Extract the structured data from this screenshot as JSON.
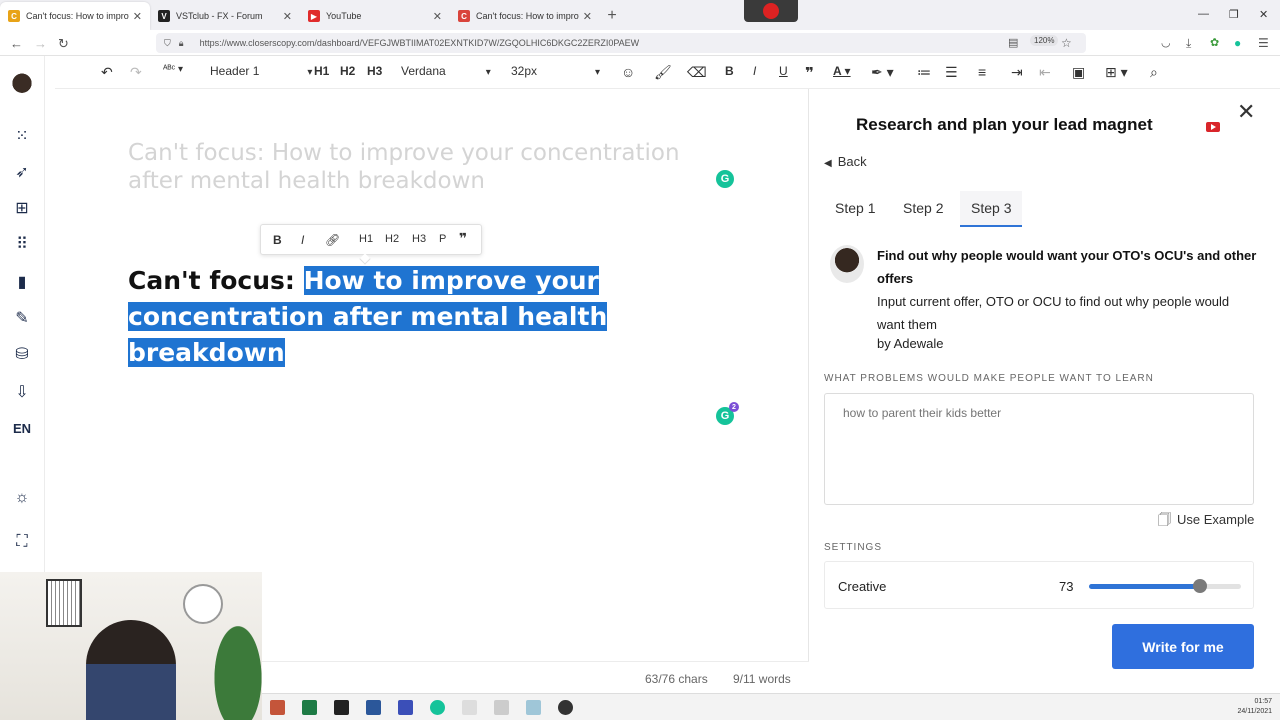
{
  "browser": {
    "tabs": [
      {
        "title": "Can't focus: How to improve y",
        "active": true,
        "favicon_color": "#e8a317",
        "favicon_glyph": "C"
      },
      {
        "title": "VSTclub - FX - Forum",
        "active": false,
        "favicon_color": "#222222",
        "favicon_glyph": "V"
      },
      {
        "title": "YouTube",
        "active": false,
        "favicon_color": "#e02b2b",
        "favicon_glyph": "▶"
      },
      {
        "title": "Can't focus: How to improve y",
        "active": false,
        "favicon_color": "#d9443b",
        "favicon_glyph": "C"
      }
    ],
    "new_tab": "+",
    "url": "https://www.closerscopy.com/dashboard/VEFGJWBTIIMAT02EXNTKID7W/ZGQOLHIC6DKGC2ZERZI0PAEW",
    "zoom": "120%"
  },
  "sidebar": {
    "language": "EN"
  },
  "toolbar": {
    "block_style": "Header 1",
    "h1": "H1",
    "h2": "H2",
    "h3": "H3",
    "font_family": "Verdana",
    "font_size": "32px",
    "bold": "B",
    "italic": "I",
    "underline": "U"
  },
  "editor": {
    "ghost_title": "Can't focus: How to improve your concentration after mental health breakdown",
    "heading_plain": "Can't focus: ",
    "heading_selected": "How to improve your concentration after mental health breakdown",
    "floating_toolbar": {
      "bold": "B",
      "italic": "I",
      "h1": "H1",
      "h2": "H2",
      "h3": "H3",
      "p": "P"
    },
    "grammarly_badge_count": "2",
    "chars": "63/76 chars",
    "words": "9/11 words"
  },
  "panel": {
    "title": "Research and plan your lead magnet",
    "back": "Back",
    "tabs": [
      "Step 1",
      "Step 2",
      "Step 3"
    ],
    "active_tab": "Step 3",
    "template_title": "Find out why people would want your OTO's OCU's and other offers",
    "template_desc": "Input current offer, OTO or OCU to find out why people would want them",
    "template_author": "by Adewale",
    "field_label": "WHAT PROBLEMS WOULD MAKE PEOPLE WANT TO LEARN",
    "field_placeholder": "how to parent their kids better",
    "use_example": "Use Example",
    "settings_label": "SETTINGS",
    "creative_label": "Creative",
    "creative_value": "73",
    "creative_max": 100,
    "write_button": "Write for me",
    "accent_color": "#2f6fde"
  },
  "taskbar": {
    "time": "01:57",
    "date": "24/11/2021"
  }
}
